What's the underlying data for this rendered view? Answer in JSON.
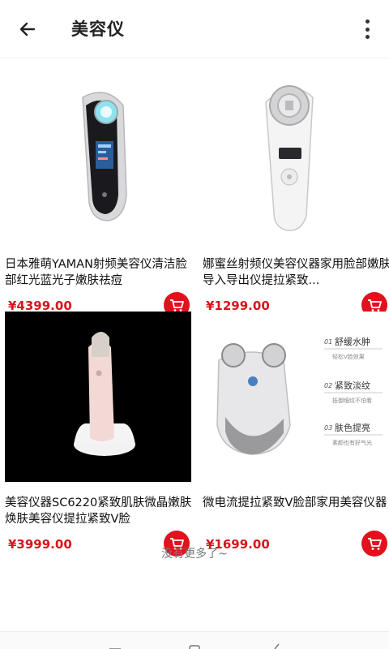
{
  "header": {
    "title": "美容仪"
  },
  "products": [
    {
      "name": "日本雅萌YAMAN射频美容仪清洁脸部红光蓝光子嫩肤祛痘",
      "price": "¥4399.00"
    },
    {
      "name": "娜蜜丝射频仪美容仪器家用脸部嫩肤导入导出仪提拉紧致...",
      "price": "¥1299.00"
    },
    {
      "name": "美容仪器SC6220紧致肌肤微晶嫩肤焕肤美容仪提拉紧致V脸",
      "price": "¥3999.00"
    },
    {
      "name": "微电流提拉紧致V脸部家用美容仪器",
      "price": "¥1699.00"
    }
  ],
  "product4_labels": {
    "label1_num": "01",
    "label1": "舒缓水肿",
    "label1_sub": "轻松V脸效果",
    "label2_num": "02",
    "label2": "紧致淡纹",
    "label2_sub": "抵御细纹不怕看",
    "label3_num": "03",
    "label3": "肤色提亮",
    "label3_sub": "素颜也有好气光"
  },
  "footer": {
    "no_more": "没有更多了~"
  },
  "colors": {
    "price": "#d8151b",
    "cart": "#e3101d"
  }
}
